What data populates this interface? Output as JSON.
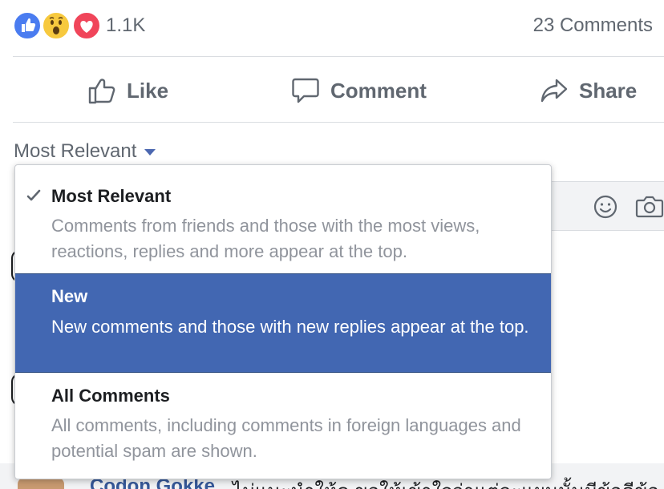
{
  "reactions": {
    "icons": [
      "like-reaction-icon",
      "wow-reaction-icon",
      "love-reaction-icon"
    ],
    "count": "1.1K"
  },
  "comments_count": "23 Comments",
  "actions": {
    "like": "Like",
    "comment": "Comment",
    "share": "Share"
  },
  "sort": {
    "current": "Most Relevant",
    "options": [
      {
        "title": "Most Relevant",
        "description": "Comments from friends and those with the most views, reactions, replies and more appear at the top.",
        "checked": true,
        "highlighted": false
      },
      {
        "title": "New",
        "description": "New comments and those with new replies appear at the top.",
        "checked": false,
        "highlighted": true
      },
      {
        "title": "All Comments",
        "description": "All comments, including comments in foreign languages and potential spam are shown.",
        "checked": false,
        "highlighted": false
      }
    ]
  },
  "bottom_comment": {
    "author": "Codon Gokke",
    "text": "ไม่แนะนำให้ดู ขอให้เข้าใจว่าแต่ละแผนนั้นมีข้อดีข้อ"
  },
  "colors": {
    "highlight": "#4267b2",
    "link": "#365899",
    "muted_text": "#90949c",
    "like_blue": "#4a7cf0",
    "love_red": "#f0455a",
    "wow_yellow": "#f7c93e"
  }
}
